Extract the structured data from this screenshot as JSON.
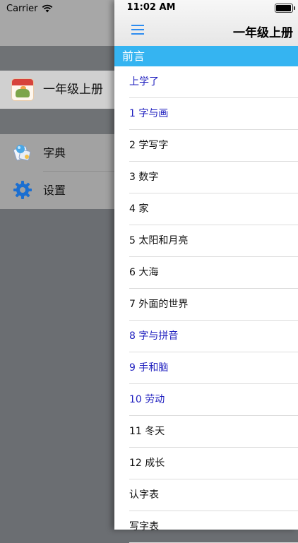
{
  "status_bar": {
    "carrier": "Carrier",
    "time": "11:02 AM"
  },
  "left_menu": {
    "book": {
      "label": "一年级上册",
      "icon": "textbook-cover-icon"
    },
    "items": [
      {
        "label": "字典",
        "icon": "dictionary-icon"
      },
      {
        "label": "设置",
        "icon": "gear-icon"
      }
    ]
  },
  "panel": {
    "title": "一年级上册",
    "menu_icon": "hamburger-menu-icon",
    "section_title": "前言",
    "accent_color": "#35b4f1",
    "link_color": "#1f1fbf",
    "lessons": [
      {
        "label": "上学了",
        "highlighted": true
      },
      {
        "label": "1 字与画",
        "highlighted": true
      },
      {
        "label": "2 学写字",
        "highlighted": false
      },
      {
        "label": "3 数字",
        "highlighted": false
      },
      {
        "label": "4 家",
        "highlighted": false
      },
      {
        "label": "5 太阳和月亮",
        "highlighted": false
      },
      {
        "label": "6 大海",
        "highlighted": false
      },
      {
        "label": "7 外面的世界",
        "highlighted": false
      },
      {
        "label": "8 字与拼音",
        "highlighted": true
      },
      {
        "label": "9 手和脑",
        "highlighted": true
      },
      {
        "label": "10 劳动",
        "highlighted": true
      },
      {
        "label": "11 冬天",
        "highlighted": false
      },
      {
        "label": "12 成长",
        "highlighted": false
      },
      {
        "label": "认字表",
        "highlighted": false
      },
      {
        "label": "写字表",
        "highlighted": false
      }
    ]
  }
}
